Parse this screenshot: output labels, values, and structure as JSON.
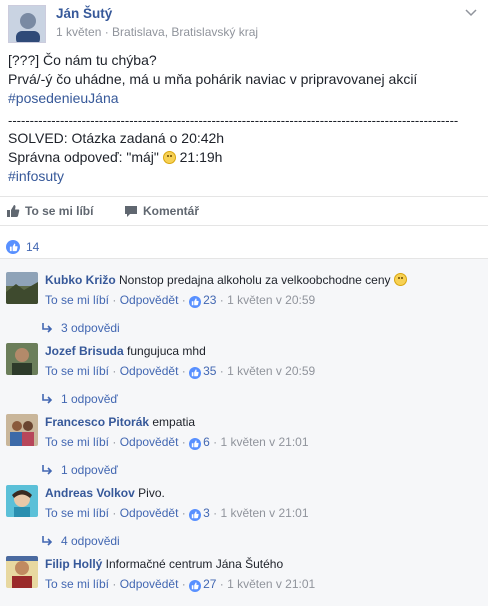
{
  "post": {
    "author": "Ján Šutý",
    "meta": "1 květen · Bratislava, Bratislavský kraj",
    "line1": "[???] Čo nám tu chýba?",
    "line2": "Prvá/-ý čo uhádne, má u mňa pohárik naviac v pripravovanej akcií",
    "hashtag1": "#posedenieuJána",
    "dashes": "--------------------------------------------------------------------------------------------------------",
    "line3": "SOLVED: Otázka zadaná o 20:42h",
    "line4a": "Správna odpoveď: \"máj\"",
    "line4b": " 21:19h",
    "hashtag2": "#infosuty"
  },
  "actions": {
    "like": "To se mi líbí",
    "comment": "Komentář"
  },
  "likes_count": "14",
  "comments": [
    {
      "name": "Kubko Križo",
      "text": " Nonstop predajna alkoholu za velkoobchodne ceny ",
      "has_emoji": true,
      "like": "To se mi líbí",
      "reply": "Odpovědět",
      "likes": "23",
      "time": "1 květen v 20:59",
      "replies": "3 odpovědi"
    },
    {
      "name": "Jozef Brisuda",
      "text": " fungujuca mhd",
      "has_emoji": false,
      "like": "To se mi líbí",
      "reply": "Odpovědět",
      "likes": "35",
      "time": "1 květen v 20:59",
      "replies": "1 odpověď"
    },
    {
      "name": "Francesco Pitorák",
      "text": " empatia",
      "has_emoji": false,
      "like": "To se mi líbí",
      "reply": "Odpovědět",
      "likes": "6",
      "time": "1 květen v 21:01",
      "replies": "1 odpověď"
    },
    {
      "name": "Andreas Volkov",
      "text": " Pivo.",
      "has_emoji": false,
      "like": "To se mi líbí",
      "reply": "Odpovědět",
      "likes": "3",
      "time": "1 květen v 21:01",
      "replies": "4 odpovědi"
    },
    {
      "name": "Filip Hollý",
      "text": " Informačné centrum Jána Šutého",
      "has_emoji": false,
      "like": "To se mi líbí",
      "reply": "Odpovědět",
      "likes": "27",
      "time": "1 květen v 21:01",
      "replies": ""
    }
  ],
  "colors": {
    "link": "#365899",
    "like_blue": "#5890ff",
    "meta_gray": "#90949c"
  }
}
